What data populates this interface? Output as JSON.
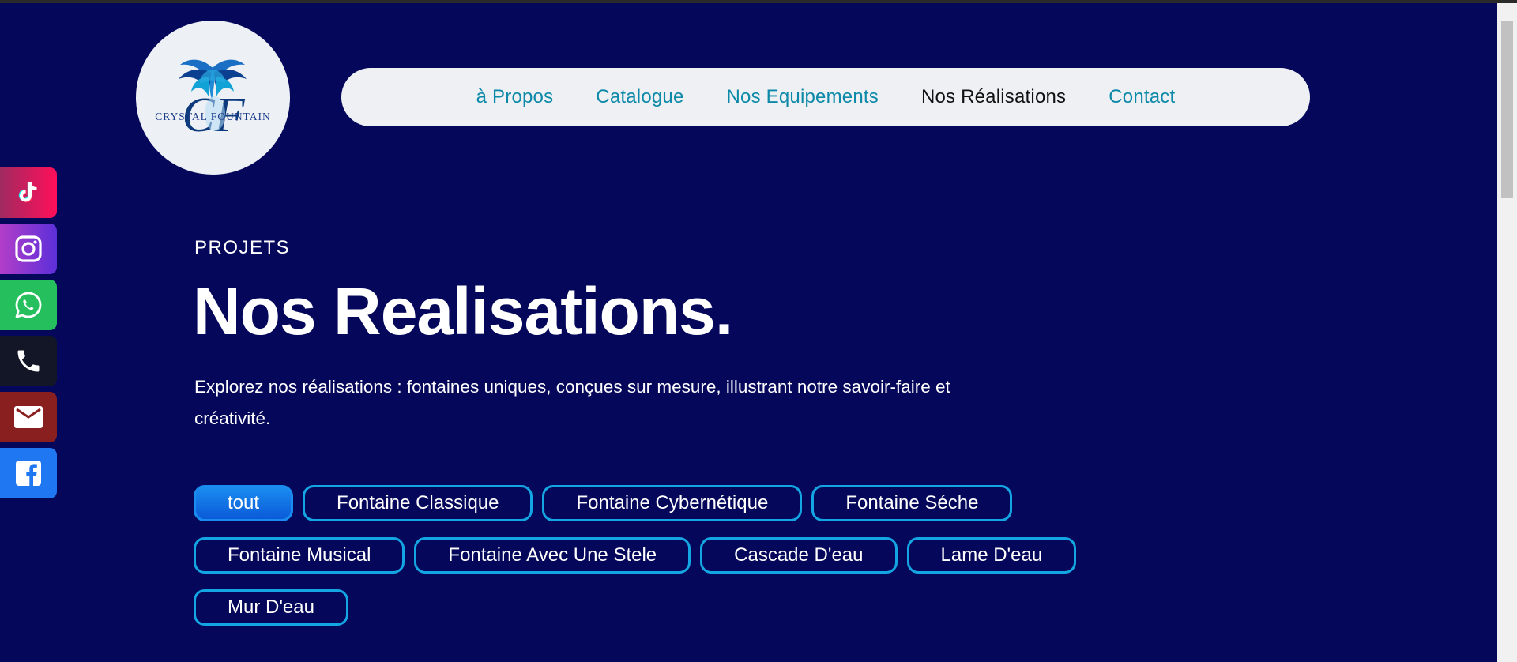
{
  "brand": {
    "monogram": "CF",
    "name": "CRYSTAL FOUNTAIN"
  },
  "nav": {
    "items": [
      {
        "label": "à Propos"
      },
      {
        "label": "Catalogue"
      },
      {
        "label": "Nos Equipements"
      },
      {
        "label": "Nos Réalisations"
      },
      {
        "label": "Contact"
      }
    ],
    "active_index": 3
  },
  "social": [
    {
      "name": "tiktok-icon"
    },
    {
      "name": "instagram-icon"
    },
    {
      "name": "whatsapp-icon"
    },
    {
      "name": "phone-icon"
    },
    {
      "name": "mail-icon"
    },
    {
      "name": "facebook-icon"
    }
  ],
  "hero": {
    "eyebrow": "PROJETS",
    "title": "Nos Realisations.",
    "description": "Explorez nos réalisations : fontaines uniques, conçues sur mesure, illustrant notre savoir-faire et créativité."
  },
  "filters": {
    "items": [
      {
        "label": "tout"
      },
      {
        "label": "Fontaine Classique"
      },
      {
        "label": "Fontaine Cybernétique"
      },
      {
        "label": "Fontaine Séche"
      },
      {
        "label": "Fontaine Musical"
      },
      {
        "label": "Fontaine Avec Une Stele"
      },
      {
        "label": "Cascade D'eau"
      },
      {
        "label": "Lame D'eau"
      },
      {
        "label": "Mur D'eau"
      }
    ],
    "active_index": 0
  },
  "colors": {
    "background": "#05075a",
    "accent": "#13a6e2",
    "nav_link": "#0c89a8"
  }
}
